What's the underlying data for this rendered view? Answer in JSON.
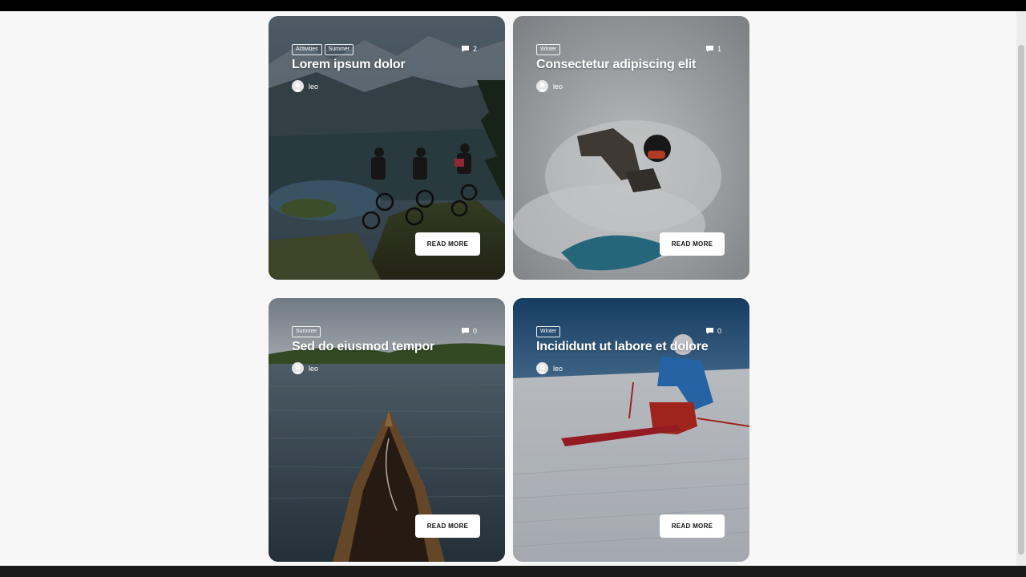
{
  "cards": [
    {
      "tags": [
        "Activities",
        "Summer"
      ],
      "comments": "2",
      "title": "Lorem ipsum dolor",
      "author": "leo",
      "button": "READ MORE",
      "image": "mountain-bikers-on-cliff"
    },
    {
      "tags": [
        "Winter"
      ],
      "comments": "1",
      "title": "Consectetur adipiscing elit",
      "author": "leo",
      "button": "READ MORE",
      "image": "snowboarder-in-powder"
    },
    {
      "tags": [
        "Summer"
      ],
      "comments": "0",
      "title": "Sed do eiusmod tempor",
      "author": "leo",
      "button": "READ MORE",
      "image": "canoe-on-lake"
    },
    {
      "tags": [
        "Winter"
      ],
      "comments": "0",
      "title": "Incididunt ut labore et dolore",
      "author": "leo",
      "button": "READ MORE",
      "image": "skier-on-slope"
    }
  ],
  "icons": {
    "comment": "comment-icon",
    "avatar": "user-avatar-icon"
  },
  "colors": {
    "page_background": "#f7f7f7",
    "button_background": "#ffffff",
    "button_text": "#111111"
  }
}
